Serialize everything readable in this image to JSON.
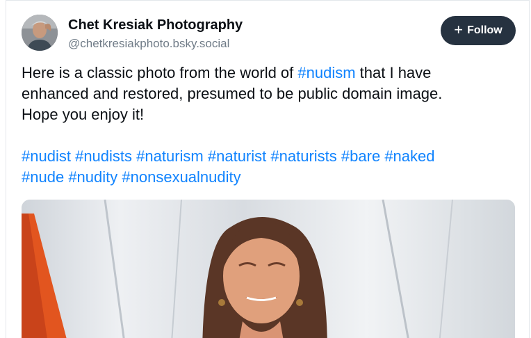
{
  "author": {
    "display_name": "Chet Kresiak Photography",
    "handle": "@chetkresiakphoto.bsky.social"
  },
  "follow_button": {
    "label": "Follow",
    "icon": "plus-icon"
  },
  "post": {
    "text_lines": [
      {
        "before": "Here is a classic photo from the world of ",
        "tag": "#nudism",
        "after": " that I have"
      },
      {
        "before": "enhanced and restored, presumed to be public domain image.",
        "tag": "",
        "after": ""
      },
      {
        "before": "Hope you enjoy it!",
        "tag": "",
        "after": ""
      }
    ],
    "hashtags_line1": [
      "#nudist",
      "#nudists",
      "#naturism",
      "#naturist",
      "#naturists",
      "#bare",
      "#naked"
    ],
    "hashtags_line2": [
      "#nude",
      "#nudity",
      "#nonsexualnudity"
    ]
  },
  "colors": {
    "link": "#1083fe",
    "text": "#0b0f14",
    "muted": "#6f7b87",
    "button_bg": "#263240"
  }
}
